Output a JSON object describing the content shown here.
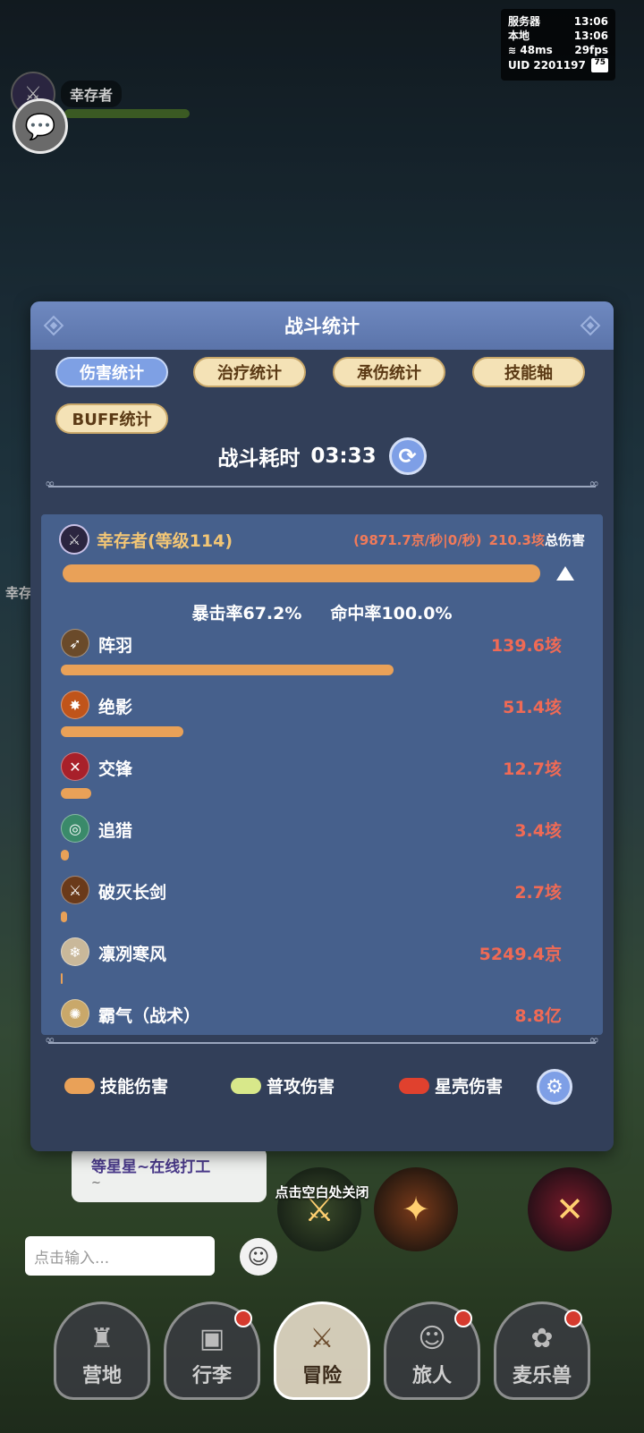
{
  "status": {
    "server_label": "服务器",
    "server_time": "13:06",
    "local_label": "本地",
    "local_time": "13:06",
    "ping": "48ms",
    "fps": "29fps",
    "uid": "UID 2201197",
    "battery": "75"
  },
  "player": {
    "name": "幸存者"
  },
  "side_label": "幸存",
  "panel": {
    "title": "战斗统计",
    "tabs": [
      "伤害统计",
      "治疗统计",
      "承伤统计",
      "技能轴",
      "BUFF统计"
    ],
    "active_tab": 0,
    "duration_label": "战斗耗时",
    "duration_value": "03:33"
  },
  "hero": {
    "name": "幸存者(等级114)",
    "dps": "(9871.7京/秒|0/秒)",
    "total": "210.3垓",
    "total_label": "总伤害",
    "bar_fraction": 1.0,
    "crit_rate": "暴击率67.2%",
    "hit_rate": "命中率100.0%"
  },
  "skills": [
    {
      "name": "阵羽",
      "value": "139.6垓",
      "fraction": 0.664,
      "icon": "feather-icon",
      "color": "#6a4a2a"
    },
    {
      "name": "绝影",
      "value": "51.4垓",
      "fraction": 0.244,
      "icon": "shadow-icon",
      "color": "#c0541a"
    },
    {
      "name": "交锋",
      "value": "12.7垓",
      "fraction": 0.06,
      "icon": "crossed-blades-icon",
      "color": "#a8202a"
    },
    {
      "name": "追猎",
      "value": "3.4垓",
      "fraction": 0.016,
      "icon": "target-icon",
      "color": "#3a8a6a"
    },
    {
      "name": "破灭长剑",
      "value": "2.7垓",
      "fraction": 0.013,
      "icon": "sword-icon",
      "color": "#6a3a1a"
    },
    {
      "name": "凛冽寒风",
      "value": "5249.4京",
      "fraction": 0.003,
      "icon": "wind-icon",
      "color": "#c9b89a"
    },
    {
      "name": "霸气（战术）",
      "value": "8.8亿",
      "fraction": 0.0,
      "icon": "aura-icon",
      "color": "#c9a86a"
    }
  ],
  "legend": [
    {
      "label": "技能伤害",
      "color": "#e9a158"
    },
    {
      "label": "普攻伤害",
      "color": "#d8e88a"
    },
    {
      "label": "星壳伤害",
      "color": "#e0412e"
    }
  ],
  "chat": {
    "bubble_text": "等星星~在线打工",
    "bubble_sub": "~",
    "close_hint": "点击空白处关闭",
    "input_placeholder": "点击输入..."
  },
  "nav": [
    {
      "label": "营地",
      "icon": "castle-icon",
      "badge": false
    },
    {
      "label": "行李",
      "icon": "chest-icon",
      "badge": true
    },
    {
      "label": "冒险",
      "icon": "crossed-swords-icon",
      "badge": false,
      "active": true
    },
    {
      "label": "旅人",
      "icon": "traveler-icon",
      "badge": true
    },
    {
      "label": "麦乐兽",
      "icon": "pet-icon",
      "badge": true
    }
  ]
}
